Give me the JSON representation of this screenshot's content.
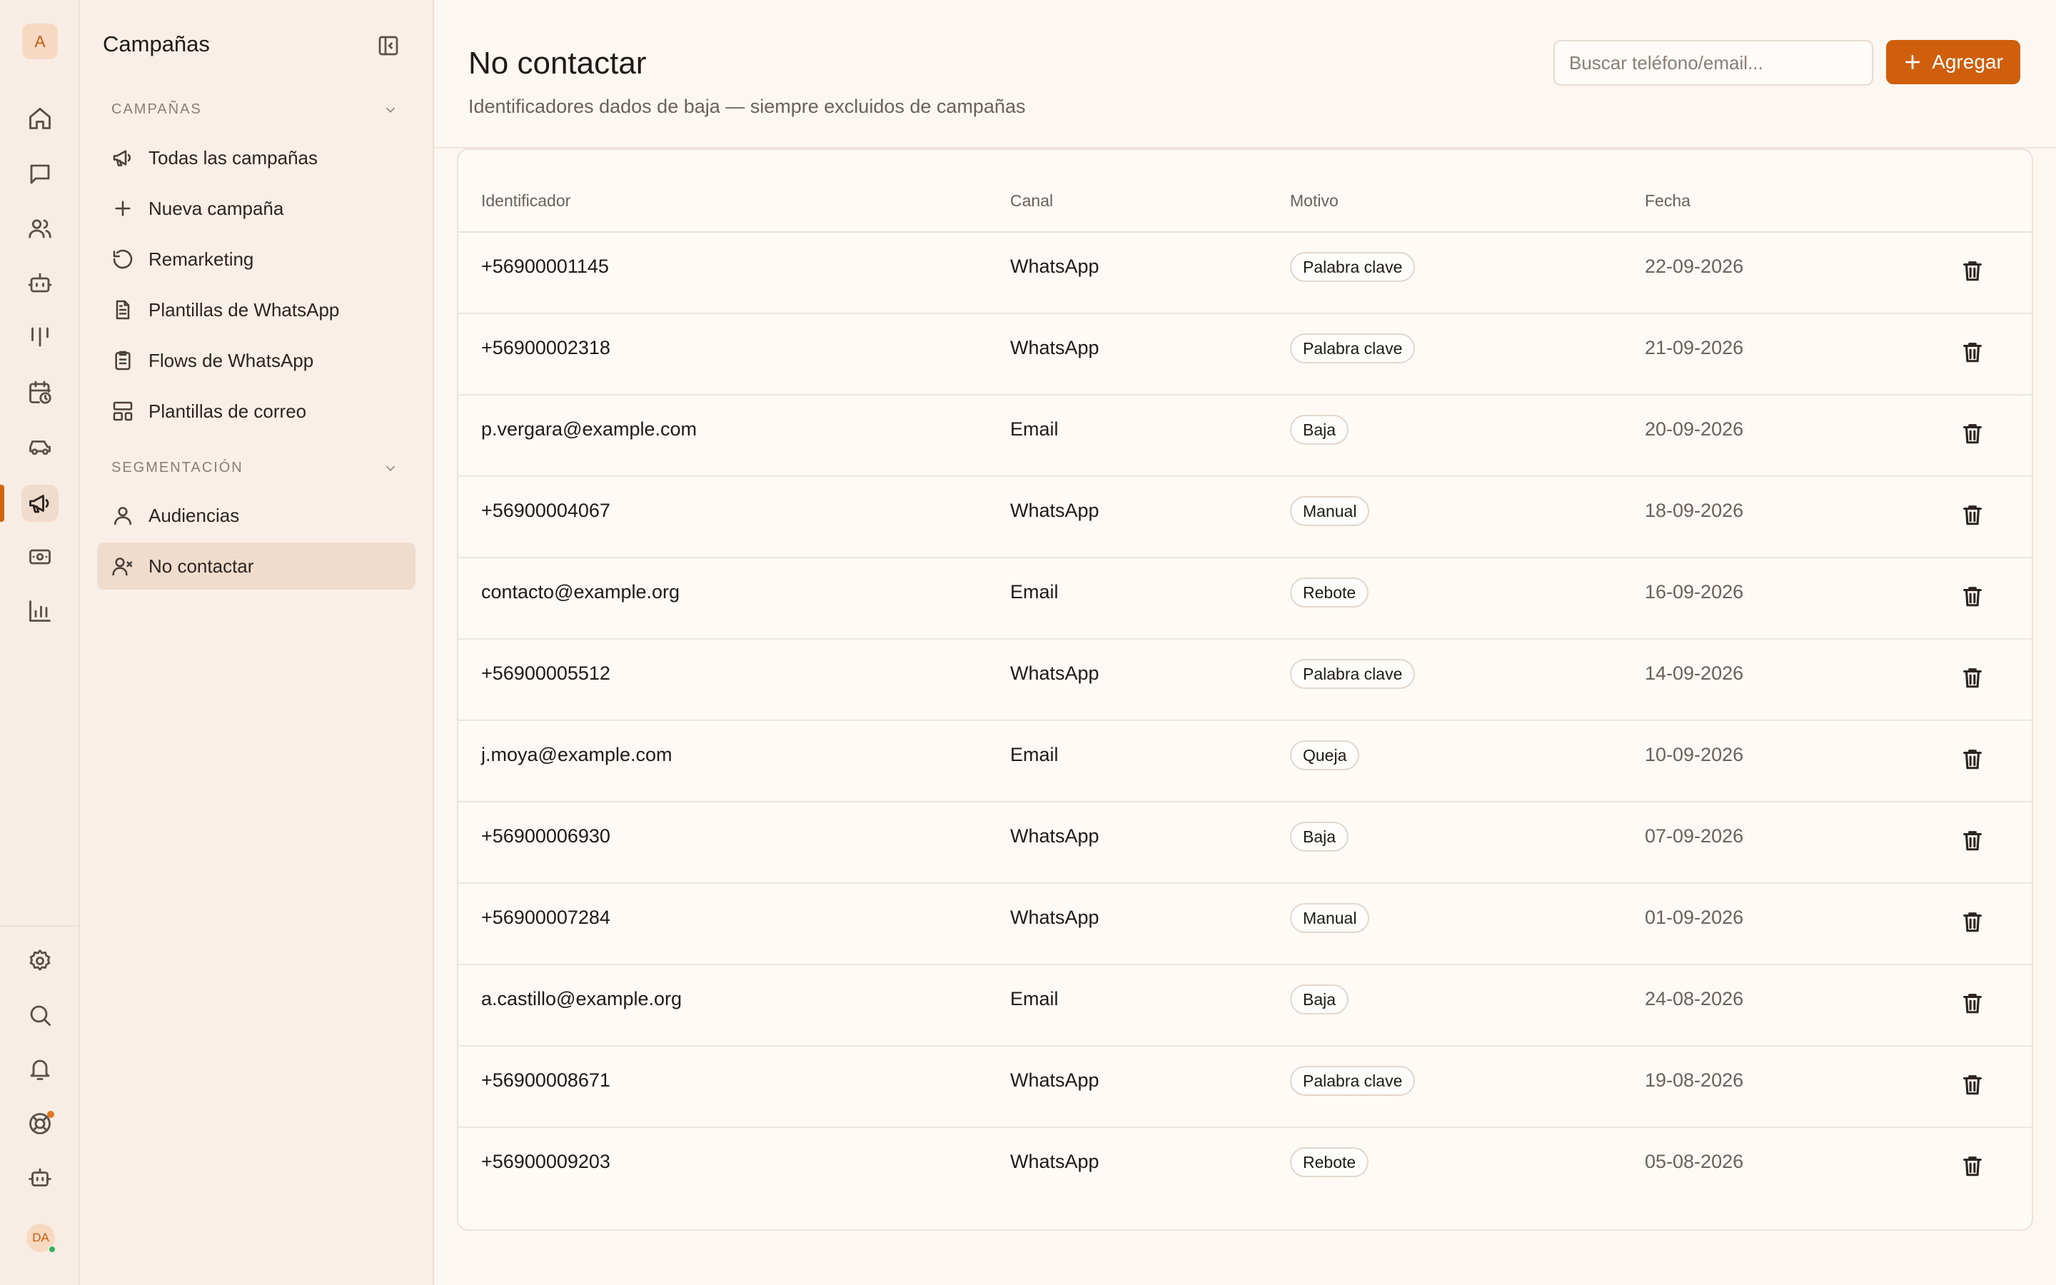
{
  "rail": {
    "workspace_initial": "A",
    "user_initials": "DA",
    "items": [
      {
        "icon": "home-icon"
      },
      {
        "icon": "chat-icon"
      },
      {
        "icon": "users-icon"
      },
      {
        "icon": "bot-icon"
      },
      {
        "icon": "kanban-icon"
      },
      {
        "icon": "calendar-clock-icon"
      },
      {
        "icon": "car-icon"
      },
      {
        "icon": "megaphone-icon",
        "active": true
      },
      {
        "icon": "cash-icon"
      },
      {
        "icon": "bar-chart-icon"
      }
    ],
    "bottom_items": [
      {
        "icon": "settings-icon"
      },
      {
        "icon": "search-icon"
      },
      {
        "icon": "bell-icon"
      },
      {
        "icon": "lifebuoy-icon"
      },
      {
        "icon": "assistant-icon"
      }
    ]
  },
  "sidebar": {
    "title": "Campañas",
    "sections": [
      {
        "label": "CAMPAÑAS",
        "items": [
          {
            "label": "Todas las campañas",
            "icon": "megaphone-icon"
          },
          {
            "label": "Nueva campaña",
            "icon": "plus-icon"
          },
          {
            "label": "Remarketing",
            "icon": "rotate-ccw-icon"
          },
          {
            "label": "Plantillas de WhatsApp",
            "icon": "file-text-icon"
          },
          {
            "label": "Flows de WhatsApp",
            "icon": "clipboard-list-icon"
          },
          {
            "label": "Plantillas de correo",
            "icon": "layout-template-icon"
          }
        ]
      },
      {
        "label": "SEGMENTACIÓN",
        "items": [
          {
            "label": "Audiencias",
            "icon": "user-icon"
          },
          {
            "label": "No contactar",
            "icon": "user-x-icon",
            "active": true
          }
        ]
      }
    ]
  },
  "header": {
    "title": "No contactar",
    "subtitle": "Identificadores dados de baja — siempre excluidos de campañas",
    "search_placeholder": "Buscar teléfono/email...",
    "add_label": "Agregar"
  },
  "table": {
    "columns": [
      "Identificador",
      "Canal",
      "Motivo",
      "Fecha"
    ],
    "rows": [
      {
        "id": "+56900001145",
        "channel": "WhatsApp",
        "reason": "Palabra clave",
        "date": "22-09-2026"
      },
      {
        "id": "+56900002318",
        "channel": "WhatsApp",
        "reason": "Palabra clave",
        "date": "21-09-2026"
      },
      {
        "id": "p.vergara@example.com",
        "channel": "Email",
        "reason": "Baja",
        "date": "20-09-2026"
      },
      {
        "id": "+56900004067",
        "channel": "WhatsApp",
        "reason": "Manual",
        "date": "18-09-2026"
      },
      {
        "id": "contacto@example.org",
        "channel": "Email",
        "reason": "Rebote",
        "date": "16-09-2026"
      },
      {
        "id": "+56900005512",
        "channel": "WhatsApp",
        "reason": "Palabra clave",
        "date": "14-09-2026"
      },
      {
        "id": "j.moya@example.com",
        "channel": "Email",
        "reason": "Queja",
        "date": "10-09-2026"
      },
      {
        "id": "+56900006930",
        "channel": "WhatsApp",
        "reason": "Baja",
        "date": "07-09-2026"
      },
      {
        "id": "+56900007284",
        "channel": "WhatsApp",
        "reason": "Manual",
        "date": "01-09-2026"
      },
      {
        "id": "a.castillo@example.org",
        "channel": "Email",
        "reason": "Baja",
        "date": "24-08-2026"
      },
      {
        "id": "+56900008671",
        "channel": "WhatsApp",
        "reason": "Palabra clave",
        "date": "19-08-2026"
      },
      {
        "id": "+56900009203",
        "channel": "WhatsApp",
        "reason": "Rebote",
        "date": "05-08-2026"
      }
    ]
  },
  "colors": {
    "accent": "#cf5f0c",
    "background": "#fdf7f2",
    "sidebar": "#f9efe8",
    "active_item": "#f0dccd",
    "online": "#2fb457"
  }
}
